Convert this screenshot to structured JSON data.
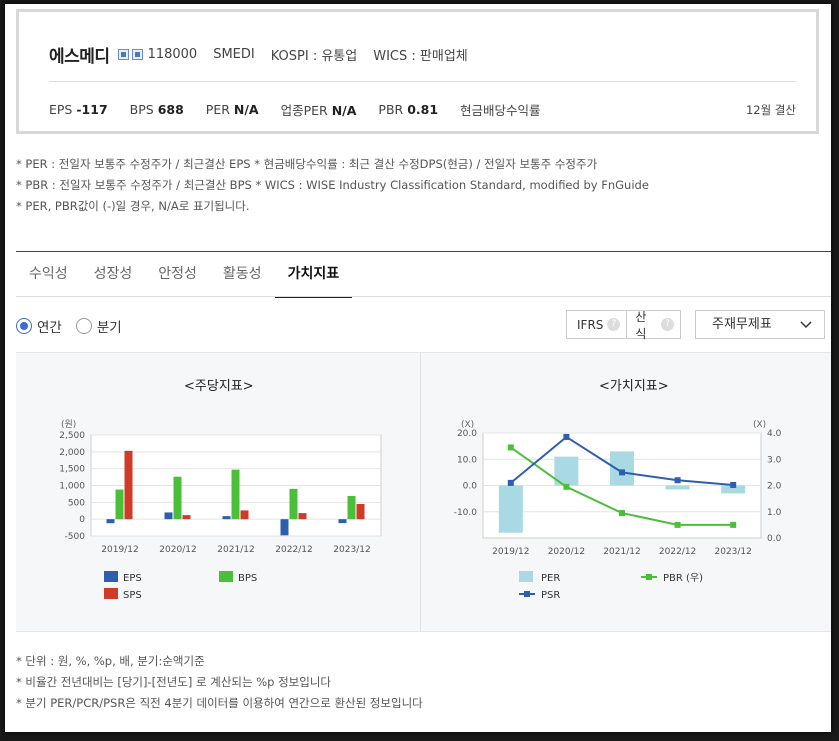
{
  "company": {
    "name": "에스메디",
    "code": "118000",
    "english_name": "SMEDI",
    "market": "KOSPI : 유통업",
    "wics": "WICS : 판매업체",
    "fiscal_note": "12월 결산"
  },
  "metrics": {
    "eps_label": "EPS",
    "eps_value": "-117",
    "bps_label": "BPS",
    "bps_value": "688",
    "per_label": "PER",
    "per_value": "N/A",
    "industry_per_label": "업종PER",
    "industry_per_value": "N/A",
    "pbr_label": "PBR",
    "pbr_value": "0.81",
    "dividend_label": "현금배당수익률"
  },
  "notes_top": [
    "* PER : 전일자 보통주 수정주가 / 최근결산 EPS * 현금배당수익률 : 최근 결산 수정DPS(현금) / 전일자 보통주 수정주가",
    "* PBR : 전일자 보통주 수정주가 / 최근결산 BPS * WICS : WISE Industry Classification Standard, modified by FnGuide",
    "* PER, PBR값이 (-)일 경우, N/A로 표기됩니다."
  ],
  "tabs": [
    "수익성",
    "성장성",
    "안정성",
    "활동성",
    "가치지표"
  ],
  "active_tab": 4,
  "period": {
    "annual": "연간",
    "quarterly": "분기"
  },
  "controls": {
    "ifrs": "IFRS",
    "calc": "산식",
    "qmark": "?",
    "select_value": "주재무제표"
  },
  "colors": {
    "eps": "#2e5fae",
    "bps": "#4cbf3a",
    "sps": "#d03a28",
    "per": "#a9d9e3",
    "pbr": "#4cbf3a",
    "psr": "#2e5fae"
  },
  "chart_data": [
    {
      "type": "bar",
      "title": "<주당지표>",
      "unit_label": "(원)",
      "categories": [
        "2019/12",
        "2020/12",
        "2021/12",
        "2022/12",
        "2023/12"
      ],
      "ylim": [
        -500,
        2500
      ],
      "yticks": [
        -500,
        0,
        500,
        1000,
        1500,
        2000,
        2500
      ],
      "ytick_labels": [
        "-500",
        "0",
        "500",
        "1,000",
        "1,500",
        "2,000",
        "2,500"
      ],
      "grid": true,
      "series": [
        {
          "name": "EPS",
          "values": [
            -120,
            200,
            90,
            -480,
            -117
          ]
        },
        {
          "name": "BPS",
          "values": [
            880,
            1260,
            1470,
            900,
            688
          ]
        },
        {
          "name": "SPS",
          "values": [
            2030,
            120,
            260,
            180,
            450
          ]
        }
      ]
    },
    {
      "type": "bar+line",
      "title": "<가치지표>",
      "left_unit_label": "(X)",
      "right_unit_label": "(X)",
      "categories": [
        "2019/12",
        "2020/12",
        "2021/12",
        "2022/12",
        "2023/12"
      ],
      "ylim_left": [
        -20,
        20
      ],
      "yticks_left": [
        "20.0",
        "10.0",
        "0.0",
        "-10.0"
      ],
      "ylim_right": [
        0,
        4
      ],
      "yticks_right": [
        "4.0",
        "3.0",
        "2.0",
        "1.0",
        "0.0"
      ],
      "series": [
        {
          "name": "PER",
          "axis": "left",
          "kind": "bar",
          "values": [
            -18,
            11,
            13,
            -1.5,
            -3
          ]
        },
        {
          "name": "PBR (우)",
          "axis": "right",
          "kind": "line",
          "values": [
            3.45,
            1.95,
            0.95,
            0.5,
            0.5
          ]
        },
        {
          "name": "PSR",
          "axis": "left",
          "kind": "line",
          "values": [
            1,
            18.5,
            5,
            2,
            0.2
          ]
        }
      ]
    }
  ],
  "notes_bottom": [
    "* 단위 : 원, %, %p, 배, 분기:순액기준",
    "* 비율간 전년대비는 [당기]-[전년도] 로 계산되는 %p 정보입니다",
    "* 분기 PER/PCR/PSR은 직전 4분기 데이터를 이용하여 연간으로 환산된 정보입니다"
  ]
}
